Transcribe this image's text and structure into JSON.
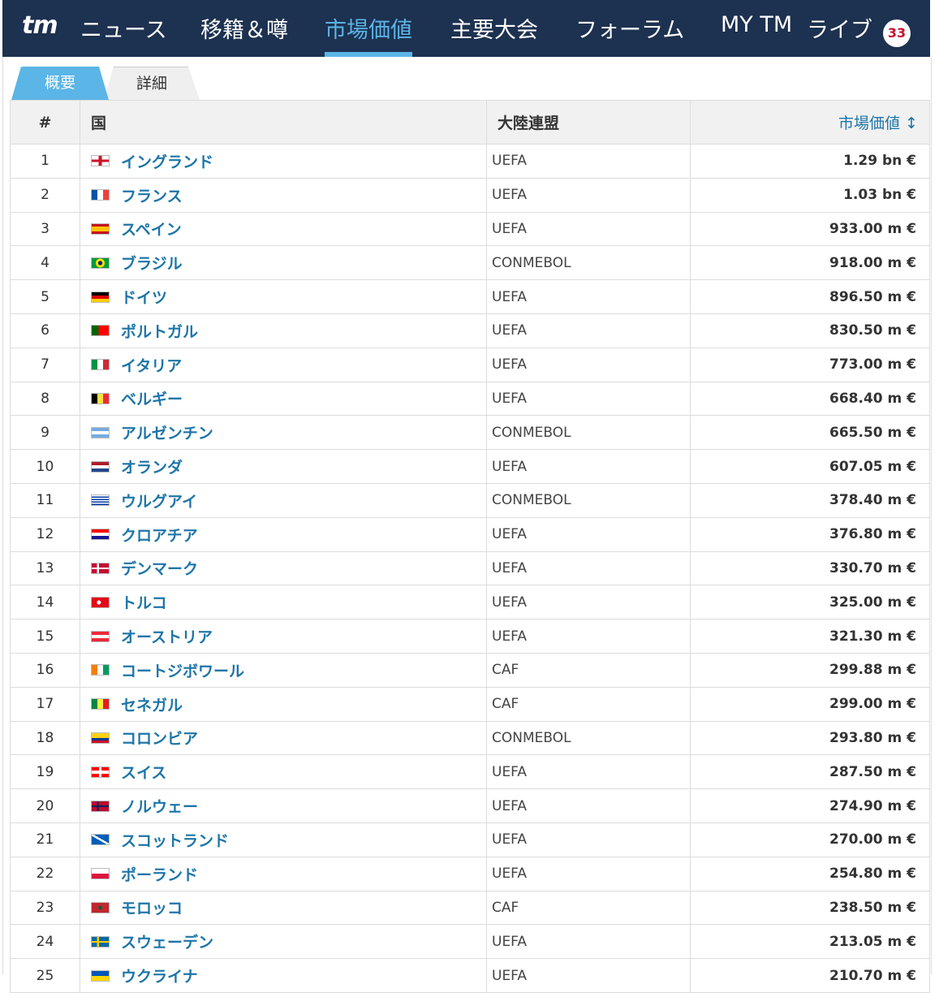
{
  "nav": {
    "logo": "tm",
    "items": [
      {
        "label": "ニュース",
        "active": false
      },
      {
        "label": "移籍＆噂",
        "active": false
      },
      {
        "label": "市場価値",
        "active": true
      },
      {
        "label": "主要大会",
        "active": false
      },
      {
        "label": "フォーラム",
        "active": false
      },
      {
        "label": "MY TM",
        "active": false
      },
      {
        "label": "ライブ",
        "active": false
      }
    ],
    "live_badge": "33"
  },
  "tabs": {
    "overview": "概要",
    "details": "詳細"
  },
  "table": {
    "headers": {
      "rank": "#",
      "country": "国",
      "confederation": "大陸連盟",
      "market_value": "市場価値 ↕"
    },
    "rows": [
      {
        "rank": "1",
        "country": "イングランド",
        "flag": "england-flag",
        "confederation": "UEFA",
        "value": "1.29 bn €"
      },
      {
        "rank": "2",
        "country": "フランス",
        "flag": "france-flag",
        "confederation": "UEFA",
        "value": "1.03 bn €"
      },
      {
        "rank": "3",
        "country": "スペイン",
        "flag": "spain-flag",
        "confederation": "UEFA",
        "value": "933.00 m €"
      },
      {
        "rank": "4",
        "country": "ブラジル",
        "flag": "brazil-flag",
        "confederation": "CONMEBOL",
        "value": "918.00 m €"
      },
      {
        "rank": "5",
        "country": "ドイツ",
        "flag": "germany-flag",
        "confederation": "UEFA",
        "value": "896.50 m €"
      },
      {
        "rank": "6",
        "country": "ポルトガル",
        "flag": "portugal-flag",
        "confederation": "UEFA",
        "value": "830.50 m €"
      },
      {
        "rank": "7",
        "country": "イタリア",
        "flag": "italy-flag",
        "confederation": "UEFA",
        "value": "773.00 m €"
      },
      {
        "rank": "8",
        "country": "ベルギー",
        "flag": "belgium-flag",
        "confederation": "UEFA",
        "value": "668.40 m €"
      },
      {
        "rank": "9",
        "country": "アルゼンチン",
        "flag": "argentina-flag",
        "confederation": "CONMEBOL",
        "value": "665.50 m €"
      },
      {
        "rank": "10",
        "country": "オランダ",
        "flag": "netherlands-flag",
        "confederation": "UEFA",
        "value": "607.05 m €"
      },
      {
        "rank": "11",
        "country": "ウルグアイ",
        "flag": "uruguay-flag",
        "confederation": "CONMEBOL",
        "value": "378.40 m €"
      },
      {
        "rank": "12",
        "country": "クロアチア",
        "flag": "croatia-flag",
        "confederation": "UEFA",
        "value": "376.80 m €"
      },
      {
        "rank": "13",
        "country": "デンマーク",
        "flag": "denmark-flag",
        "confederation": "UEFA",
        "value": "330.70 m €"
      },
      {
        "rank": "14",
        "country": "トルコ",
        "flag": "turkey-flag",
        "confederation": "UEFA",
        "value": "325.00 m €"
      },
      {
        "rank": "15",
        "country": "オーストリア",
        "flag": "austria-flag",
        "confederation": "UEFA",
        "value": "321.30 m €"
      },
      {
        "rank": "16",
        "country": "コートジボワール",
        "flag": "ivory-coast-flag",
        "confederation": "CAF",
        "value": "299.88 m €"
      },
      {
        "rank": "17",
        "country": "セネガル",
        "flag": "senegal-flag",
        "confederation": "CAF",
        "value": "299.00 m €"
      },
      {
        "rank": "18",
        "country": "コロンビア",
        "flag": "colombia-flag",
        "confederation": "CONMEBOL",
        "value": "293.80 m €"
      },
      {
        "rank": "19",
        "country": "スイス",
        "flag": "switzerland-flag",
        "confederation": "UEFA",
        "value": "287.50 m €"
      },
      {
        "rank": "20",
        "country": "ノルウェー",
        "flag": "norway-flag",
        "confederation": "UEFA",
        "value": "274.90 m €"
      },
      {
        "rank": "21",
        "country": "スコットランド",
        "flag": "scotland-flag",
        "confederation": "UEFA",
        "value": "270.00 m €"
      },
      {
        "rank": "22",
        "country": "ポーランド",
        "flag": "poland-flag",
        "confederation": "UEFA",
        "value": "254.80 m €"
      },
      {
        "rank": "23",
        "country": "モロッコ",
        "flag": "morocco-flag",
        "confederation": "CAF",
        "value": "238.50 m €"
      },
      {
        "rank": "24",
        "country": "スウェーデン",
        "flag": "sweden-flag",
        "confederation": "UEFA",
        "value": "213.05 m €"
      },
      {
        "rank": "25",
        "country": "ウクライナ",
        "flag": "ukraine-flag",
        "confederation": "UEFA",
        "value": "210.70 m €"
      }
    ]
  },
  "colors": {
    "nav_bg": "#1d3150",
    "accent": "#5bb5e6",
    "link": "#1d75a8",
    "badge_text": "#c8102e"
  }
}
